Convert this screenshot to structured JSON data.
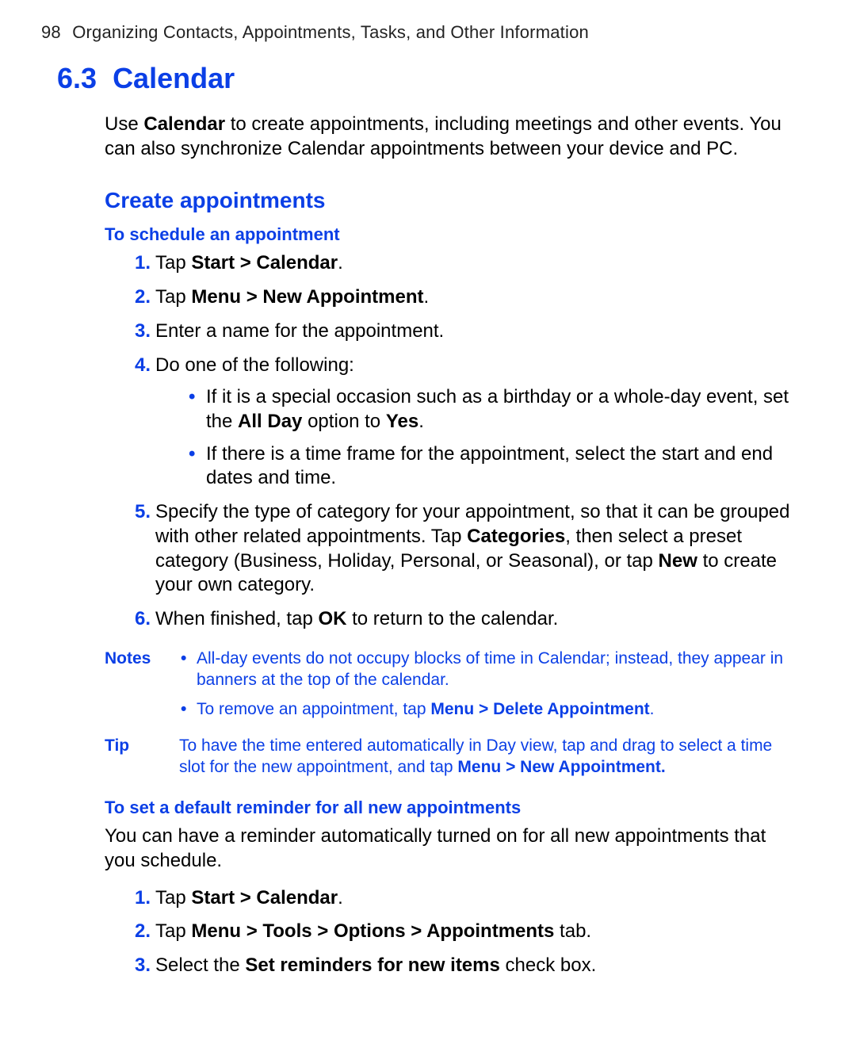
{
  "header": {
    "page_number": "98",
    "running_title": "Organizing Contacts, Appointments, Tasks, and Other Information"
  },
  "section": {
    "number": "6.3",
    "title": "Calendar",
    "intro_pre": "Use ",
    "intro_bold": "Calendar",
    "intro_post": " to create appointments, including meetings and other events. You can also synchronize Calendar appointments between your device and PC."
  },
  "create": {
    "heading": "Create appointments",
    "sub1": "To schedule an appointment",
    "steps": [
      {
        "n": "1.",
        "pre": "Tap ",
        "b": "Start > Calendar",
        "post": "."
      },
      {
        "n": "2.",
        "pre": "Tap ",
        "b": "Menu > New Appointment",
        "post": "."
      },
      {
        "n": "3.",
        "pre": "Enter a name for the appointment.",
        "b": "",
        "post": ""
      },
      {
        "n": "4.",
        "pre": "Do one of the following:",
        "b": "",
        "post": ""
      },
      {
        "n": "5.",
        "pre": "Specify the type of category for your appointment, so that it can be grouped with other related appointments. Tap ",
        "b": "Categories",
        "post": ", then select a preset category (Business, Holiday, Personal, or Seasonal), or tap ",
        "b2": "New",
        "post2": " to create your own category."
      },
      {
        "n": "6.",
        "pre": "When finished, tap ",
        "b": "OK",
        "post": " to return to the calendar."
      }
    ],
    "sub_bullets": [
      {
        "pre": "If it is a special occasion such as a birthday or a whole-day event, set the ",
        "b1": "All Day",
        "mid": " option to ",
        "b2": "Yes",
        "post": "."
      },
      {
        "pre": "If there is a time frame for the appointment, select the start and end dates and time.",
        "b1": "",
        "mid": "",
        "b2": "",
        "post": ""
      }
    ]
  },
  "notes": {
    "label": "Notes",
    "items": [
      {
        "text": "All-day events do not occupy blocks of time in Calendar; instead, they appear in banners at the top of the calendar.",
        "b": ""
      },
      {
        "text": "To remove an appointment, tap ",
        "b": "Menu > Delete Appointment",
        "post": "."
      }
    ]
  },
  "tip": {
    "label": "Tip",
    "text_pre": "To have the time entered automatically in Day view, tap and drag to select a time slot for the new appointment, and tap ",
    "text_b": "Menu > New Appointment.",
    "text_post": ""
  },
  "reminder": {
    "heading": "To set a default reminder for all new appointments",
    "desc": "You can have a reminder automatically turned on for all new appointments that you schedule.",
    "steps": [
      {
        "n": "1.",
        "pre": "Tap ",
        "b": "Start > Calendar",
        "post": "."
      },
      {
        "n": "2.",
        "pre": "Tap ",
        "b": "Menu > Tools > Options > Appointments",
        "post": " tab."
      },
      {
        "n": "3.",
        "pre": "Select the ",
        "b": "Set reminders for new items",
        "post": " check box."
      }
    ]
  }
}
